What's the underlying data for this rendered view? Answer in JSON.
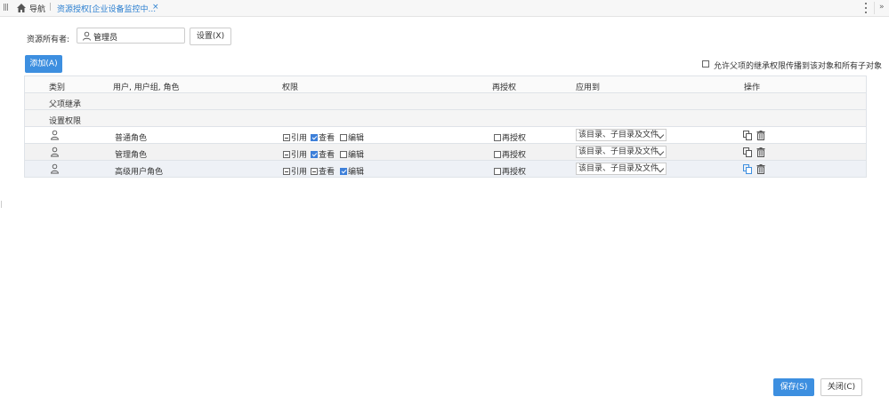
{
  "topbar": {
    "nav_label": "导航",
    "separator": "|",
    "tab_label": "资源授权[企业设备监控中...",
    "tab_close": "×",
    "collapse": "»"
  },
  "owner": {
    "label": "资源所有者:",
    "value": "管理员",
    "set_button": "设置(X)"
  },
  "add_button": "添加(A)",
  "inherit_option": "允许父项的继承权限传播到该对象和所有子对象",
  "table": {
    "headers": {
      "type": "类别",
      "users": "用户, 用户组, 角色",
      "perms": "权限",
      "regrant": "再授权",
      "apply": "应用到",
      "ops": "操作"
    },
    "groups": [
      "父项继承",
      "设置权限"
    ],
    "perm_labels": {
      "ref": "引用",
      "view": "查看",
      "edit": "编辑",
      "regrant": "再授权"
    },
    "rows": [
      {
        "name": "普通角色",
        "apply_to": "该目录、子目录及文件",
        "ref": "indeterminate",
        "view": true,
        "edit": false,
        "regrant": false
      },
      {
        "name": "管理角色",
        "apply_to": "该目录、子目录及文件",
        "ref": "indeterminate",
        "view": true,
        "edit": false,
        "regrant": false
      },
      {
        "name": "高级用户角色",
        "apply_to": "该目录、子目录及文件",
        "ref": "indeterminate",
        "view": "indeterminate",
        "edit": true,
        "regrant": false
      }
    ]
  },
  "footer": {
    "save": "保存(S)",
    "close": "关闭(C)"
  },
  "colors": {
    "primary": "#3d8fe0",
    "tab_text": "#2b7fd0"
  }
}
